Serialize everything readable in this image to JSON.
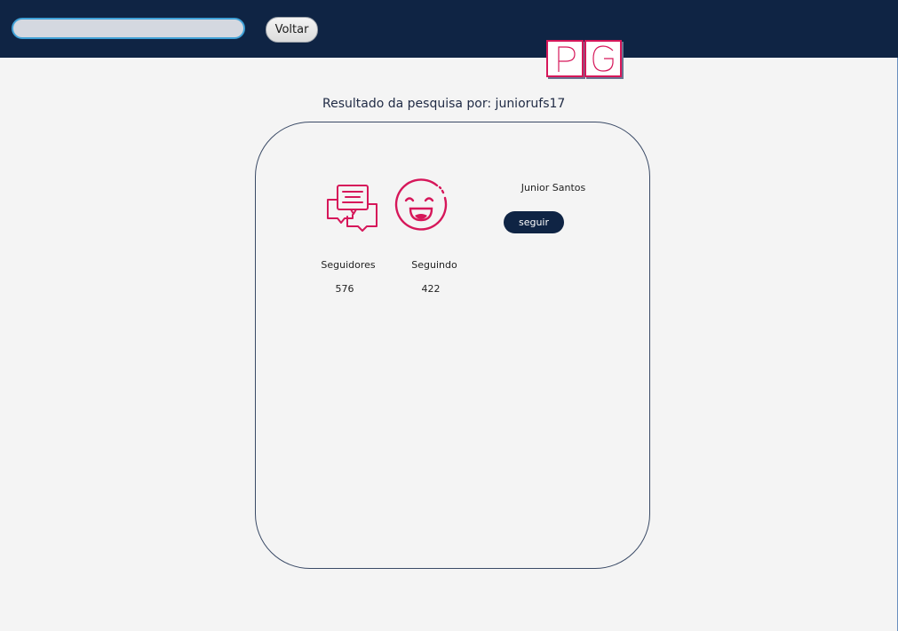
{
  "header": {
    "search": {
      "value": "",
      "placeholder": ""
    },
    "back_label": "Voltar",
    "logo": {
      "letters": [
        "P",
        "G"
      ],
      "color": "#d6175a"
    }
  },
  "result": {
    "heading": "Resultado da pesquisa por: juniorufs17"
  },
  "profile": {
    "name": "Junior Santos",
    "follow_label": "seguir",
    "followers_label": "Seguidores",
    "followers_count": "576",
    "following_label": "Seguindo",
    "following_count": "422",
    "icons": [
      "chat-bubbles-icon",
      "smiley-face-icon"
    ]
  },
  "colors": {
    "header_bg": "#0f2444",
    "accent": "#d6175a",
    "background": "#f4f4f4",
    "button_dark": "#0f2444"
  }
}
